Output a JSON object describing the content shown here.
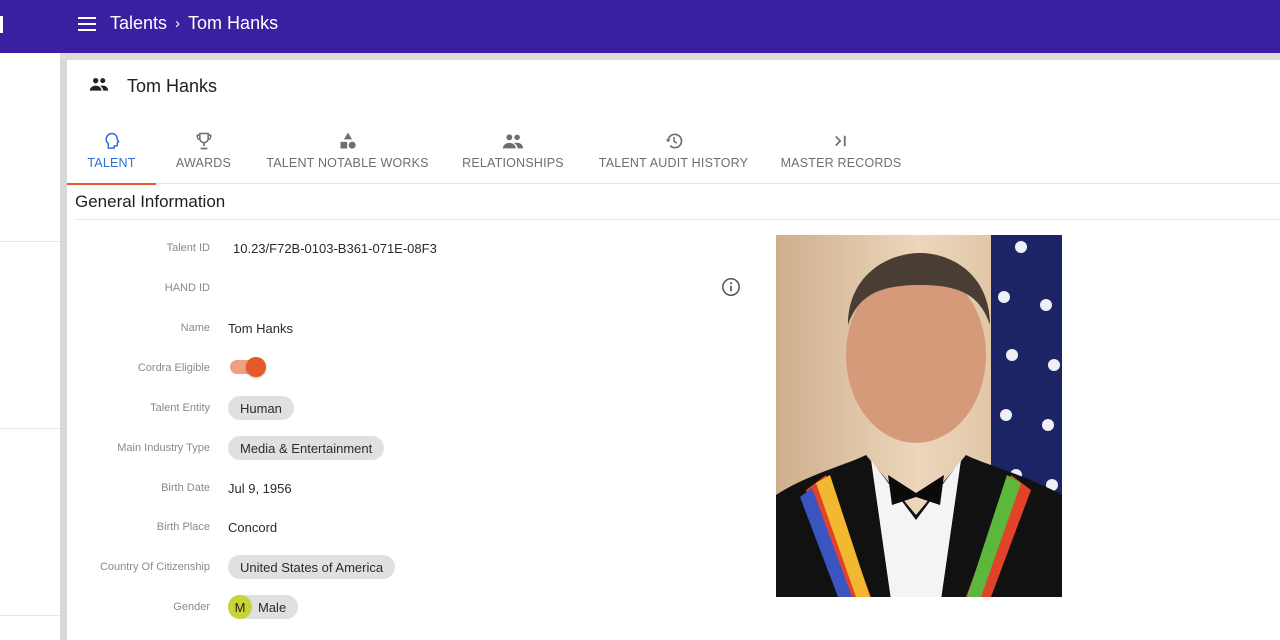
{
  "topbar": {
    "menu_icon": "hamburger-menu-icon",
    "breadcrumb": [
      "Talents",
      "Tom Hanks"
    ],
    "separator_icon": "chevron-right-icon"
  },
  "page": {
    "title": "Tom Hanks",
    "title_icon": "people-icon"
  },
  "tabs": [
    {
      "label": "TALENT",
      "icon": "head-profile-icon",
      "active": true
    },
    {
      "label": "AWARDS",
      "icon": "trophy-icon",
      "active": false
    },
    {
      "label": "TALENT NOTABLE WORKS",
      "icon": "shapes-icon",
      "active": false
    },
    {
      "label": "RELATIONSHIPS",
      "icon": "people-icon",
      "active": false
    },
    {
      "label": "TALENT AUDIT HISTORY",
      "icon": "history-icon",
      "active": false
    },
    {
      "label": "MASTER RECORDS",
      "icon": "skip-next-icon",
      "active": false
    }
  ],
  "section": {
    "title": "General Information"
  },
  "fields": {
    "talent_id": {
      "label": "Talent ID",
      "value": "10.23/F72B-0103-B361-071E-08F3"
    },
    "hand_id": {
      "label": "HAND ID",
      "value": "",
      "info_icon": "info-icon"
    },
    "name": {
      "label": "Name",
      "value": "Tom Hanks"
    },
    "cordra_eligible": {
      "label": "Cordra Eligible",
      "value": true
    },
    "talent_entity": {
      "label": "Talent Entity",
      "value": "Human"
    },
    "main_industry_type": {
      "label": "Main Industry Type",
      "value": "Media & Entertainment"
    },
    "birth_date": {
      "label": "Birth Date",
      "value": "Jul 9, 1956"
    },
    "birth_place": {
      "label": "Birth Place",
      "value": "Concord"
    },
    "country_of_citizenship": {
      "label": "Country Of Citizenship",
      "value": "United States of America"
    },
    "gender": {
      "label": "Gender",
      "value": "Male",
      "avatar": "M"
    }
  },
  "photo": {
    "alt": "Tom Hanks portrait"
  },
  "colors": {
    "topbar": "#3a1fa0",
    "active_tab": "#2f6fd6",
    "tab_indicator": "#e4572e",
    "toggle_on": "#e35a27",
    "gender_avatar": "#c6d435"
  }
}
